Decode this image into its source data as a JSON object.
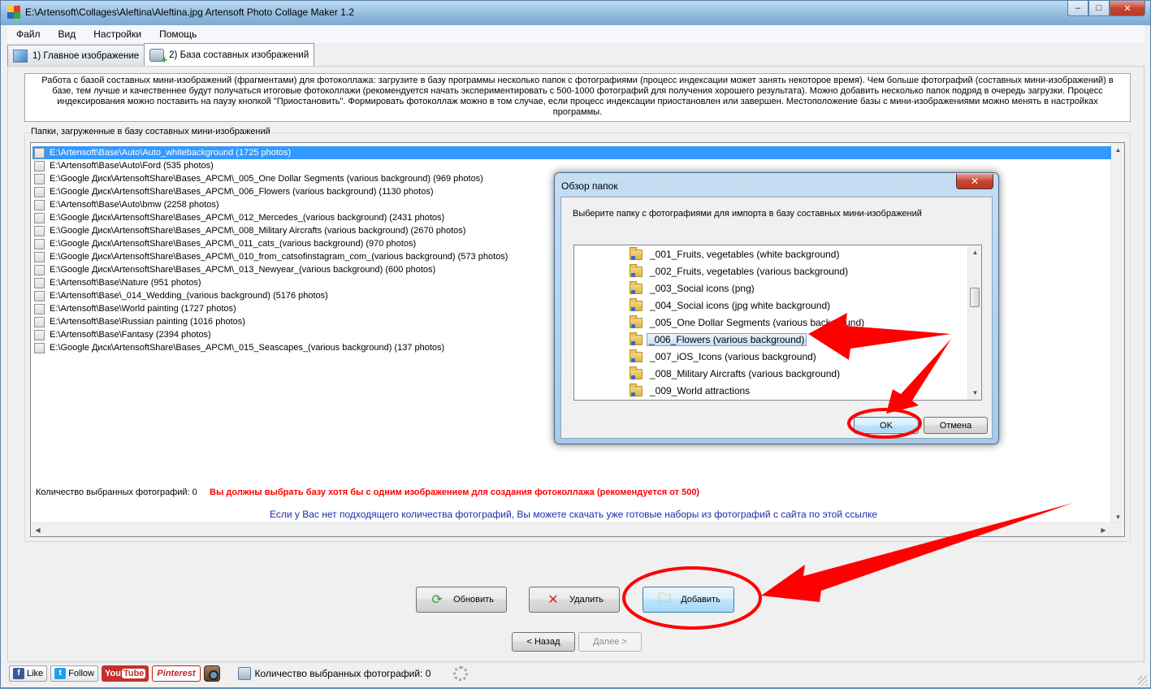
{
  "window": {
    "title": "E:\\Artensoft\\Collages\\Aleftina\\Aleftina.jpg Artensoft Photo Collage Maker 1.2",
    "min_glyph": "–",
    "max_glyph": "□",
    "close_glyph": "✕"
  },
  "menu": [
    "Файл",
    "Вид",
    "Настройки",
    "Помощь"
  ],
  "tabs": [
    {
      "label": "1) Главное изображение",
      "active": false
    },
    {
      "label": "2) База составных изображений",
      "active": true
    }
  ],
  "info_text": "Работа с базой составных мини-изображений (фрагментами) для фотоколлажа: загрузите в базу программы несколько папок с фотографиями (процесс индексации может занять некоторое время). Чем больше фотографий (составных мини-изображений) в базе, тем лучше и качественнее будут получаться итоговые фотоколлажи (рекомендуется начать экспериментировать с 500-1000 фотографий для получения хорошего результата). Можно добавить несколько папок подряд в очередь загрузки. Процесс индексирования можно поставить на паузу кнопкой \"Приостановить\". Формировать фотоколлаж можно в том случае, если процесс индексации приостановлен или завершен. Местоположение базы с мини-изображениями можно менять в настройках программы.",
  "folders_group_label": "Папки, загруженные в базу составных мини-изображений",
  "folders": [
    "E:\\Artensoft\\Base\\Auto\\Auto_whitebackground (1725 photos)",
    "E:\\Artensoft\\Base\\Auto\\Ford (535 photos)",
    "E:\\Google Диск\\ArtensoftShare\\Bases_APCM\\_005_One Dollar Segments (various background) (969 photos)",
    "E:\\Google Диск\\ArtensoftShare\\Bases_APCM\\_006_Flowers (various background) (1130 photos)",
    "E:\\Artensoft\\Base\\Auto\\bmw (2258 photos)",
    "E:\\Google Диск\\ArtensoftShare\\Bases_APCM\\_012_Mercedes_(various background) (2431 photos)",
    "E:\\Google Диск\\ArtensoftShare\\Bases_APCM\\_008_Military Aircrafts (various background) (2670 photos)",
    "E:\\Google Диск\\ArtensoftShare\\Bases_APCM\\_011_cats_(various background) (970 photos)",
    "E:\\Google Диск\\ArtensoftShare\\Bases_APCM\\_010_from_catsofinstagram_com_(various background) (573 photos)",
    "E:\\Google Диск\\ArtensoftShare\\Bases_APCM\\_013_Newyear_(various background) (600 photos)",
    "E:\\Artensoft\\Base\\Nature (951 photos)",
    "E:\\Artensoft\\Base\\_014_Wedding_(various background) (5176 photos)",
    "E:\\Artensoft\\Base\\World painting (1727 photos)",
    "E:\\Artensoft\\Base\\Russian painting (1016 photos)",
    "E:\\Artensoft\\Base\\Fantasy (2394 photos)",
    "E:\\Google Диск\\ArtensoftShare\\Bases_APCM\\_015_Seascapes_(various background) (137 photos)"
  ],
  "selected_count_label": "Количество выбранных фотографий: 0",
  "warning": "Вы должны выбрать базу хотя бы с одним изображением для создания фотоколлажа (рекомендуется от 500)",
  "download_link": "Если у Вас нет подходящего количества фотографий, Вы можете скачать уже готовые наборы из фотографий с сайта по этой ссылке",
  "buttons": {
    "refresh": "Обновить",
    "delete": "Удалить",
    "add": "Добавить",
    "back": "< Назад",
    "next": "Далее >"
  },
  "statusbar": {
    "like": "Like",
    "follow": "Follow",
    "youtube_you": "You",
    "youtube_tube": "Tube",
    "pinterest": "Pinterest",
    "count": "Количество выбранных фотографий: 0"
  },
  "dialog": {
    "title": "Обзор папок",
    "close_glyph": "✕",
    "prompt": "Выберите папку с фотографиями для импорта в базу составных мини-изображений",
    "folders": [
      "_001_Fruits, vegetables (white background)",
      "_002_Fruits, vegetables (various background)",
      "_003_Social icons (png)",
      "_004_Social icons (jpg white background)",
      "_005_One Dollar Segments (various background)",
      "_006_Flowers (various background)",
      "_007_iOS_Icons (various background)",
      "_008_Military Aircrafts (various background)",
      "_009_World attractions"
    ],
    "selected_index": 5,
    "ok": "OK",
    "cancel": "Отмена"
  },
  "colors": {
    "annotation_red": "#ff0000",
    "warning_red": "#ff0000",
    "link_blue": "#1f2aa8",
    "selection_blue": "#3399ff"
  }
}
